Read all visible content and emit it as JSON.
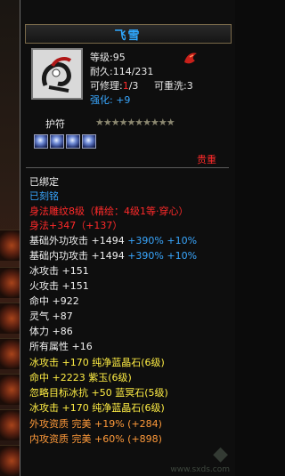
{
  "title": "飞雪",
  "level_label": "等级:95",
  "durability_label": "耐久:114/231",
  "repair_prefix": "可修理:",
  "repair_count": "1",
  "repair_total": "/3",
  "wash_label": "可重洗:3",
  "strength_prefix": "强化:",
  "strength_value": "+9",
  "talisman_label": "护符",
  "stars": "★★★★★★★★★★",
  "rarity": "贵重",
  "bound": "已绑定",
  "engraved": "已刻铭",
  "body_engrave": "身法雕纹8级（精绘：4级1等·穿心）",
  "body_bonus": "身法+347（+137）",
  "stats": [
    {
      "name": "基础外功攻击 +1494",
      "extra": "+390% +10%"
    },
    {
      "name": "基础内功攻击 +1494",
      "extra": "+390% +10%"
    }
  ],
  "attrs": [
    "冰攻击 +151",
    "火攻击 +151",
    "命中 +922",
    "灵气 +87",
    "体力 +86",
    "所有属性 +16"
  ],
  "gems": [
    "冰攻击 +170 纯净蓝晶石(6级)",
    "命中 +2223 紫玉(6级)",
    "忽略目标冰抗 +50 蓝冥石(5级)",
    "冰攻击 +170 纯净蓝晶石(6级)"
  ],
  "aptitude": [
    "外攻资质    完美 +19% (+284)",
    "内攻资质    完美 +60% (+898)"
  ],
  "watermark": "www.sxds.com",
  "colors": {
    "title": "#2fa8ff",
    "red": "#ff2a2a",
    "yellow": "#ffee44",
    "orange": "#ff9a3a"
  }
}
